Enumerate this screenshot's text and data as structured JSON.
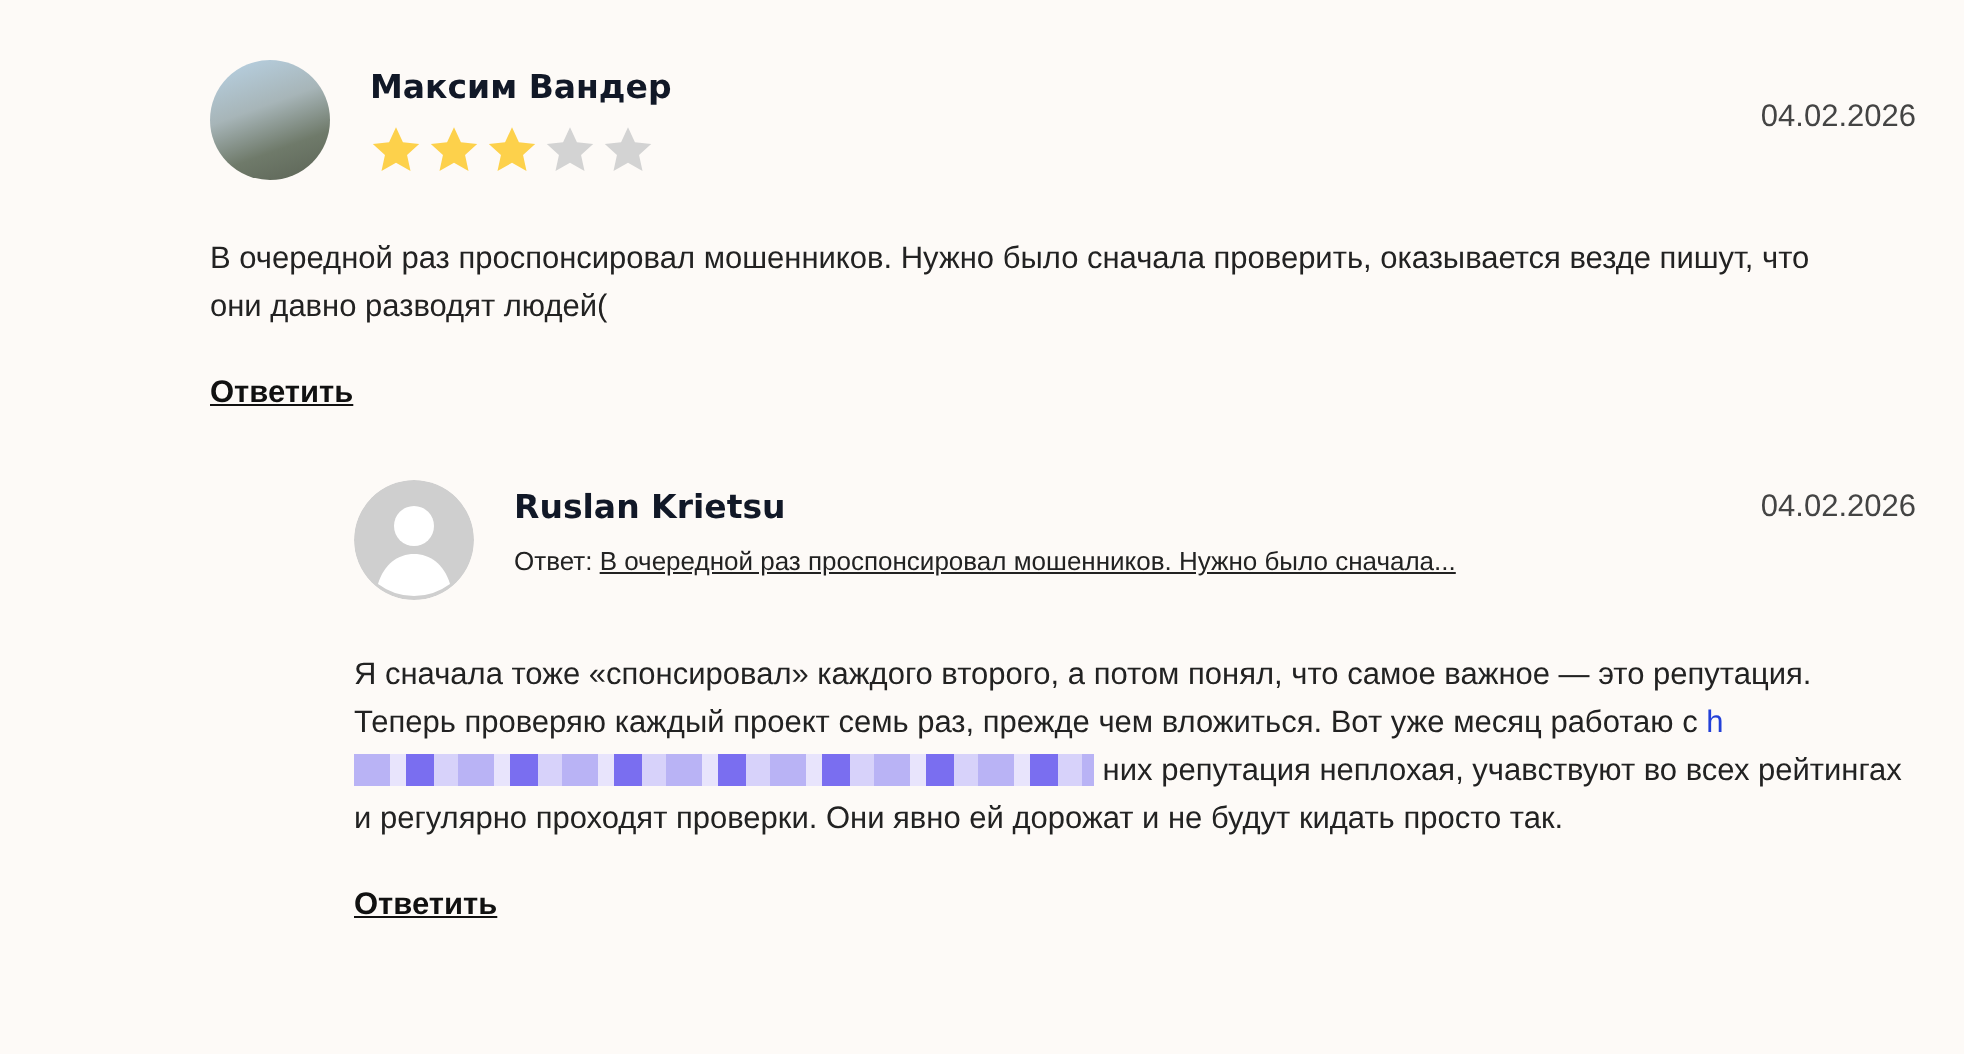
{
  "comments": [
    {
      "author": "Максим Вандер",
      "avatar": {
        "kind": "photo"
      },
      "stars": 3,
      "date": "04.02.2026",
      "body": [
        {
          "kind": "text",
          "text": "В очередной раз проспонсировал мошенников. Нужно было сначала проверить, оказывается везде пишут, что они давно разводят людей("
        }
      ],
      "reply_button": "Ответить",
      "replies": [
        {
          "author": "Ruslan Krietsu",
          "avatar": {
            "kind": "silhouette"
          },
          "date": "04.02.2026",
          "reply_to_label": "Ответ:",
          "reply_to_link": "В очередной раз проспонсировал мошенников. Нужно было сначала...",
          "body": [
            {
              "kind": "text",
              "text": "Я сначала тоже «спонсировал» каждого второго, а потом понял, что самое важное — это репутация. Теперь проверяю каждый проект семь раз, прежде чем вложиться. Вот уже месяц работаю с "
            },
            {
              "kind": "link",
              "text": "h"
            },
            {
              "kind": "redacted"
            },
            {
              "kind": "text",
              "text": " них репутация неплохая, учавствуют во всех рейтингах и регулярно проходят проверки. Они явно ей дорожат и не будут кидать просто так."
            }
          ],
          "reply_button": "Ответить"
        }
      ]
    }
  ]
}
